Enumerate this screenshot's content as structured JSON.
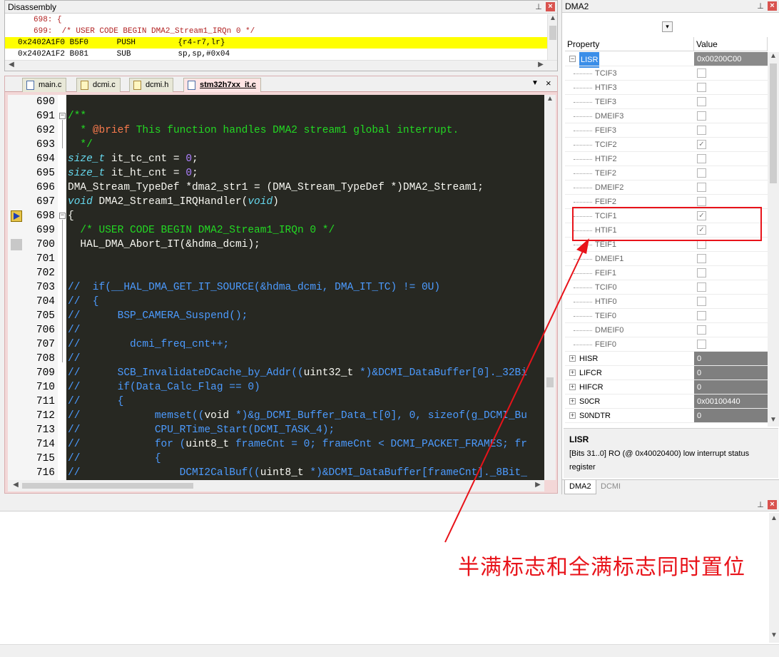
{
  "disassembly": {
    "title": "Disassembly",
    "pin": "⊥",
    "close": "×",
    "lines": [
      {
        "text": "698: {",
        "kind": "src"
      },
      {
        "text": "699:  /* USER CODE BEGIN DMA2_Stream1_IRQn 0 */",
        "kind": "src"
      },
      {
        "text": "0x2402A1F0 B5F0      PUSH         {r4-r7,lr}",
        "kind": "cur"
      },
      {
        "text": "0x2402A1F2 B081      SUB          sp,sp,#0x04",
        "kind": "asm"
      }
    ]
  },
  "editor": {
    "tabs": [
      {
        "label": "main.c",
        "icon": "c-file-icon",
        "active": false
      },
      {
        "label": "dcmi.c",
        "icon": "c-file-icon",
        "active": false
      },
      {
        "label": "dcmi.h",
        "icon": "h-file-icon",
        "active": false
      },
      {
        "label": "stm32h7xx_it.c",
        "icon": "c-file-icon",
        "active": true
      }
    ],
    "tab_dropdown": "▼",
    "tab_close": "×",
    "lines": [
      {
        "n": "690",
        "html": ""
      },
      {
        "n": "691",
        "html": "<span class=\"c-cm\">/**</span>"
      },
      {
        "n": "692",
        "html": "<span class=\"c-cm\">  * </span><span class=\"c-tag\">@brief</span><span class=\"c-cm\"> This function handles DMA2 stream1 global interrupt.</span>"
      },
      {
        "n": "693",
        "html": "<span class=\"c-cm\">  */</span>"
      },
      {
        "n": "694",
        "html": "<span class=\"c-kw\">size_t</span> it_tc_cnt = <span class=\"c-num\">0</span>;"
      },
      {
        "n": "695",
        "html": "<span class=\"c-kw\">size_t</span> it_ht_cnt = <span class=\"c-num\">0</span>;"
      },
      {
        "n": "696",
        "html": "DMA_Stream_TypeDef *dma2_str1 = (DMA_Stream_TypeDef *)DMA2_Stream1;"
      },
      {
        "n": "697",
        "html": "<span class=\"c-kw\">void</span> DMA2_Stream1_IRQHandler(<span class=\"c-kw\">void</span>)"
      },
      {
        "n": "698",
        "html": "{"
      },
      {
        "n": "699",
        "html": "  <span class=\"c-cm\">/* USER CODE BEGIN DMA2_Stream1_IRQn 0 */</span>"
      },
      {
        "n": "700",
        "html": "  HAL_DMA_Abort_IT(&amp;hdma_dcmi);"
      },
      {
        "n": "701",
        "html": ""
      },
      {
        "n": "702",
        "html": ""
      },
      {
        "n": "703",
        "html": "<span class=\"c-blue\">//  if(__HAL_DMA_GET_IT_SOURCE(&amp;hdma_dcmi, DMA_IT_TC) != 0U)</span>"
      },
      {
        "n": "704",
        "html": "<span class=\"c-blue\">//  {</span>"
      },
      {
        "n": "705",
        "html": "<span class=\"c-blue\">//      BSP_CAMERA_Suspend();</span>"
      },
      {
        "n": "706",
        "html": "<span class=\"c-blue\">//</span>"
      },
      {
        "n": "707",
        "html": "<span class=\"c-blue\">//        dcmi_freq_cnt++;</span>"
      },
      {
        "n": "708",
        "html": "<span class=\"c-blue\">//</span>"
      },
      {
        "n": "709",
        "html": "<span class=\"c-blue\">//      SCB_InvalidateDCache_by_Addr((</span>uint32_t<span class=\"c-blue\"> *)&amp;DCMI_DataBuffer[0]._32Bi</span>"
      },
      {
        "n": "710",
        "html": "<span class=\"c-blue\">//      if(Data_Calc_Flag == 0)</span>"
      },
      {
        "n": "711",
        "html": "<span class=\"c-blue\">//      {</span>"
      },
      {
        "n": "712",
        "html": "<span class=\"c-blue\">//            memset((</span>void<span class=\"c-blue\"> *)&amp;g_DCMI_Buffer_Data_t[0], 0, sizeof(g_DCMI_Bu</span>"
      },
      {
        "n": "713",
        "html": "<span class=\"c-blue\">//            CPU_RTime_Start(DCMI_TASK_4);</span>"
      },
      {
        "n": "714",
        "html": "<span class=\"c-blue\">//            for (</span>uint8_t<span class=\"c-blue\"> frameCnt = 0; frameCnt &lt; DCMI_PACKET_FRAMES; fr</span>"
      },
      {
        "n": "715",
        "html": "<span class=\"c-blue\">//            {</span>"
      },
      {
        "n": "716",
        "html": "<span class=\"c-blue\">//                DCMI2CalBuf((</span>uint8_t<span class=\"c-blue\"> *)&amp;DCMI_DataBuffer[frameCnt]._8Bit_</span>"
      }
    ]
  },
  "dma_panel": {
    "title": "DMA2",
    "pin": "⊥",
    "close": "×",
    "combo_arrow": "▾",
    "col_property": "Property",
    "col_value": "Value",
    "rows": [
      {
        "name": "LISR",
        "value": "0x00200C00",
        "level": 0,
        "expander": "−",
        "selected": true
      },
      {
        "name": "TCIF3",
        "level": 1,
        "checked": false
      },
      {
        "name": "HTIF3",
        "level": 1,
        "checked": false
      },
      {
        "name": "TEIF3",
        "level": 1,
        "checked": false
      },
      {
        "name": "DMEIF3",
        "level": 1,
        "checked": false
      },
      {
        "name": "FEIF3",
        "level": 1,
        "checked": false
      },
      {
        "name": "TCIF2",
        "level": 1,
        "checked": true
      },
      {
        "name": "HTIF2",
        "level": 1,
        "checked": false
      },
      {
        "name": "TEIF2",
        "level": 1,
        "checked": false
      },
      {
        "name": "DMEIF2",
        "level": 1,
        "checked": false
      },
      {
        "name": "FEIF2",
        "level": 1,
        "checked": false
      },
      {
        "name": "TCIF1",
        "level": 1,
        "checked": true
      },
      {
        "name": "HTIF1",
        "level": 1,
        "checked": true
      },
      {
        "name": "TEIF1",
        "level": 1,
        "checked": false
      },
      {
        "name": "DMEIF1",
        "level": 1,
        "checked": false
      },
      {
        "name": "FEIF1",
        "level": 1,
        "checked": false
      },
      {
        "name": "TCIF0",
        "level": 1,
        "checked": false
      },
      {
        "name": "HTIF0",
        "level": 1,
        "checked": false
      },
      {
        "name": "TEIF0",
        "level": 1,
        "checked": false
      },
      {
        "name": "DMEIF0",
        "level": 1,
        "checked": false
      },
      {
        "name": "FEIF0",
        "level": 1,
        "checked": false
      },
      {
        "name": "HISR",
        "value": "0",
        "level": 0,
        "expander": "+"
      },
      {
        "name": "LIFCR",
        "value": "0",
        "level": 0,
        "expander": "+"
      },
      {
        "name": "HIFCR",
        "value": "0",
        "level": 0,
        "expander": "+"
      },
      {
        "name": "S0CR",
        "value": "0x00100440",
        "level": 0,
        "expander": "+"
      },
      {
        "name": "S0NDTR",
        "value": "0",
        "level": 0,
        "expander": "+"
      }
    ],
    "check_glyph": "✓",
    "desc_title": "LISR",
    "desc_text": "[Bits 31..0] RO (@ 0x40020400) low interrupt status register",
    "tabs": [
      {
        "label": "DMA2",
        "active": true
      },
      {
        "label": "DCMI",
        "active": false
      }
    ]
  },
  "bottom_panel": {
    "pin": "⊥",
    "close": "×"
  },
  "annotation": {
    "text": "半满标志和全满标志同时置位",
    "color": "#e8131a"
  }
}
